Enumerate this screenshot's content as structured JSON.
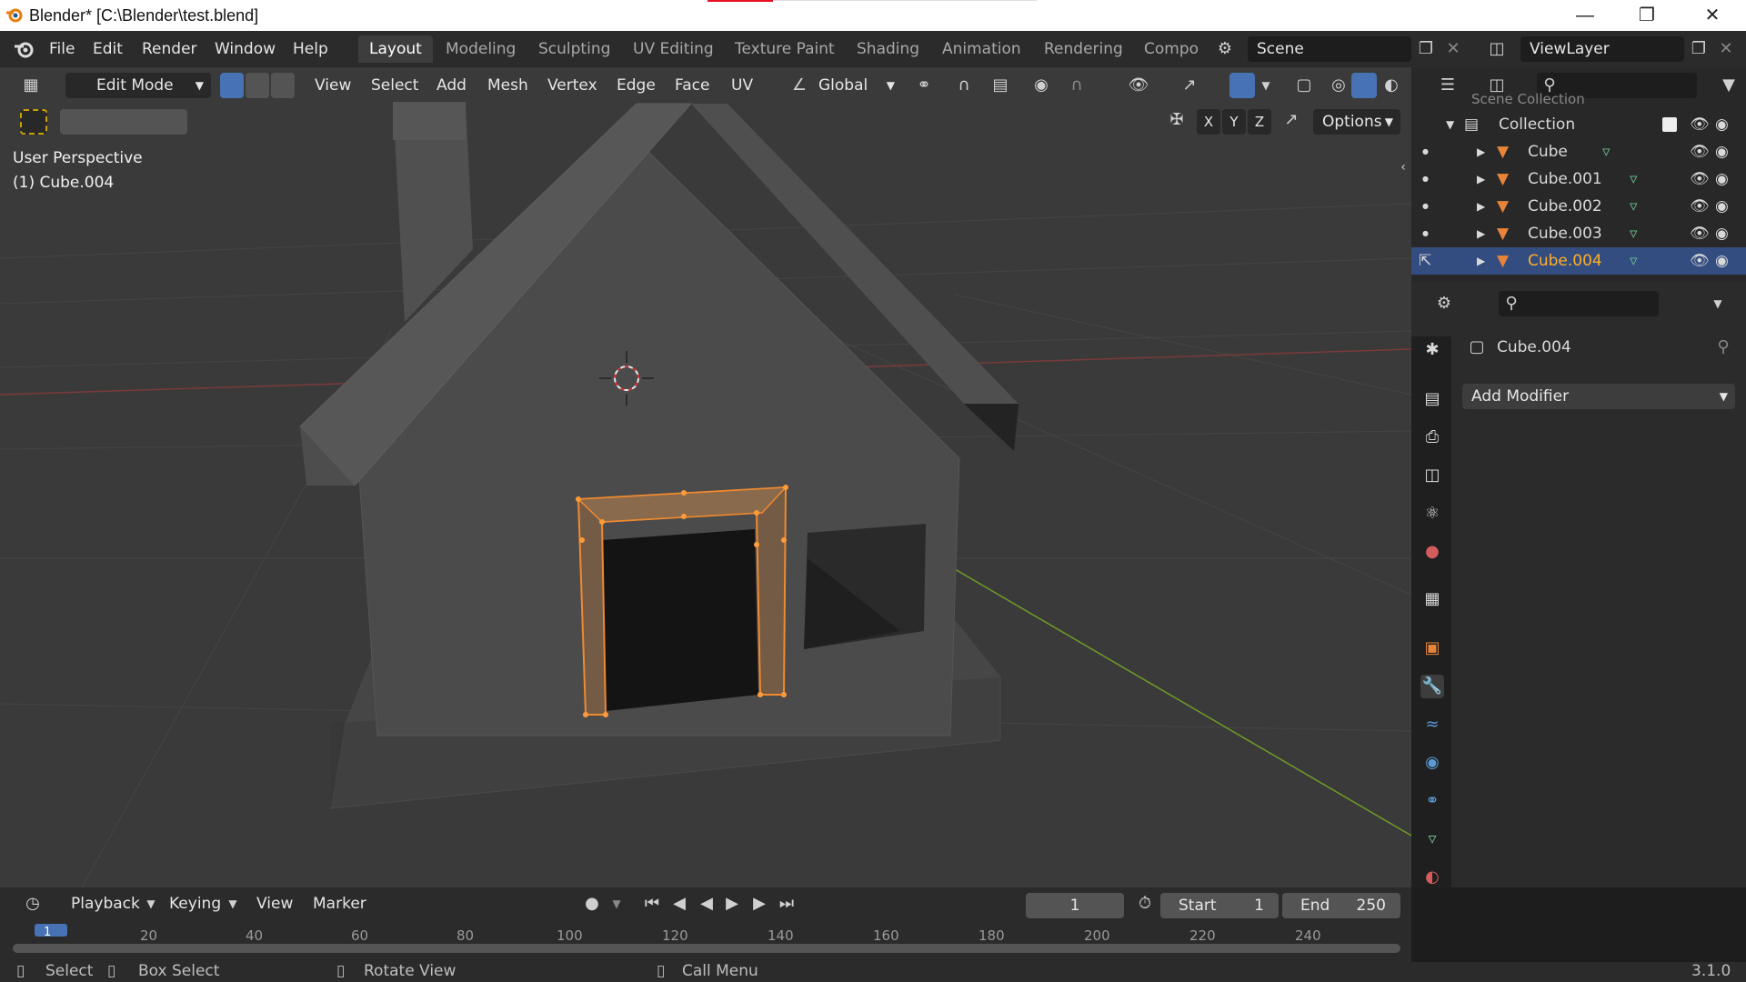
{
  "window": {
    "title": "Blender* [C:\\Blender\\test.blend]",
    "controls": [
      "minimize-icon",
      "restore-icon",
      "close-icon"
    ]
  },
  "menubar": {
    "menus": [
      "File",
      "Edit",
      "Render",
      "Window",
      "Help"
    ],
    "workspaces": [
      "Layout",
      "Modeling",
      "Sculpting",
      "UV Editing",
      "Texture Paint",
      "Shading",
      "Animation",
      "Rendering",
      "Compo"
    ],
    "active_workspace": "Layout",
    "scene": "Scene",
    "view_layer": "ViewLayer"
  },
  "viewport_header": {
    "mode": "Edit Mode",
    "menus": [
      "View",
      "Select",
      "Add",
      "Mesh",
      "Vertex",
      "Edge",
      "Face",
      "UV"
    ],
    "transform_orientation": "Global",
    "axes": [
      "X",
      "Y",
      "Z"
    ],
    "options_label": "Options"
  },
  "viewport": {
    "perspective_label": "User Perspective",
    "object_label": "(1) Cube.004",
    "colors": {
      "background": "#3a3a3a",
      "selection": "#e8843a",
      "x_axis": "#8a3a3a",
      "y_axis": "#6f9a2a"
    }
  },
  "outliner": {
    "scene_collection": "Scene Collection",
    "collection": "Collection",
    "objects": [
      "Cube",
      "Cube.001",
      "Cube.002",
      "Cube.003",
      "Cube.004"
    ],
    "selected": "Cube.004"
  },
  "properties": {
    "object_name": "Cube.004",
    "add_modifier_label": "Add Modifier",
    "tabs": [
      "tool-icon",
      "render-icon",
      "output-icon",
      "view-layer-icon",
      "scene-icon",
      "world-icon",
      "collection-icon",
      "object-icon",
      "modifier-icon",
      "particles-icon",
      "physics-icon",
      "constraints-icon",
      "data-icon",
      "material-icon"
    ]
  },
  "timeline": {
    "menus": [
      "Playback",
      "Keying",
      "View",
      "Marker"
    ],
    "current_frame": "1",
    "start_label": "Start",
    "start_value": "1",
    "end_label": "End",
    "end_value": "250",
    "ticks": [
      "1",
      "20",
      "40",
      "60",
      "80",
      "100",
      "120",
      "140",
      "160",
      "180",
      "200",
      "220",
      "240"
    ]
  },
  "statusbar": {
    "select": "Select",
    "box_select": "Box Select",
    "rotate_view": "Rotate View",
    "call_menu": "Call Menu",
    "version": "3.1.0"
  }
}
